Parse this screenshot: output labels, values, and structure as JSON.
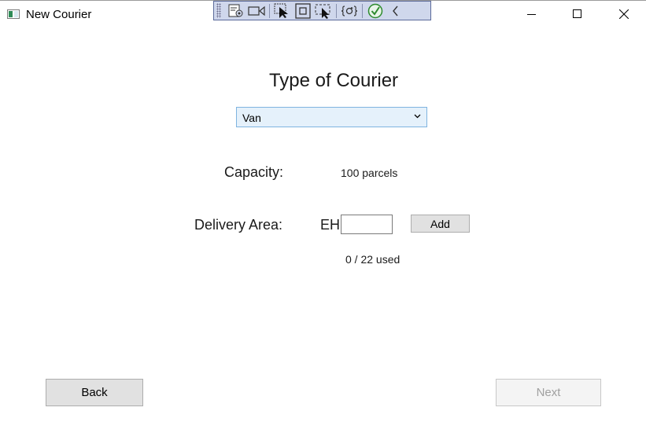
{
  "window": {
    "title": "New Courier"
  },
  "debug_toolbar": {
    "buttons": [
      "live-visual-tree-icon",
      "record-icon",
      "select-element-icon",
      "display-adorners-icon",
      "track-focus-icon",
      "hot-reload-icon",
      "check-icon",
      "collapse-icon"
    ]
  },
  "form": {
    "heading": "Type of Courier",
    "courier_type": {
      "selected": "Van"
    },
    "capacity": {
      "label": "Capacity:",
      "value": "100 parcels"
    },
    "delivery_area": {
      "label": "Delivery Area:",
      "prefix": "EH",
      "input_value": "",
      "add_label": "Add",
      "usage": "0 / 22 used"
    }
  },
  "footer": {
    "back_label": "Back",
    "next_label": "Next",
    "next_enabled": false
  },
  "colors": {
    "combo_bg": "#e5f1fb",
    "combo_border": "#7fb4e0",
    "toolbar_bg": "#cfd7ec"
  }
}
